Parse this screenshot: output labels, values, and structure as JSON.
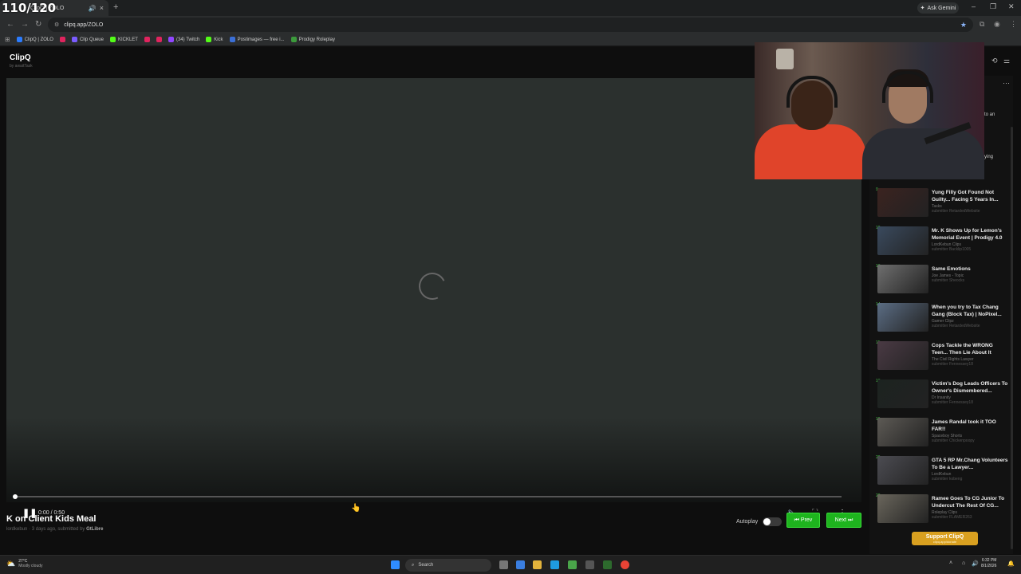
{
  "overlay": {
    "counter": "110/120"
  },
  "browser": {
    "tab_title": "ClipQ | ZOLO",
    "ask_gemini": "Ask Gemini",
    "url": "clipq.app/ZOLO",
    "bookmarks": [
      {
        "label": "ClipQ | ZOLO",
        "color": "#2b7cff"
      },
      {
        "label": "",
        "color": "#e0245e"
      },
      {
        "label": "Clip Queue",
        "color": "#7a5cff"
      },
      {
        "label": "KICKLET",
        "color": "#53fc18"
      },
      {
        "label": "",
        "color": "#e0245e"
      },
      {
        "label": "",
        "color": "#e0245e"
      },
      {
        "label": "(34) Twitch",
        "color": "#9146ff"
      },
      {
        "label": "Kick",
        "color": "#53fc18"
      },
      {
        "label": "Postimages — free i...",
        "color": "#3b6fd6"
      },
      {
        "label": "Prodigy Roleplay",
        "color": "#3c9a3c"
      }
    ]
  },
  "app": {
    "brand": "ClipQ",
    "brand_sub": "by awaitTask"
  },
  "player": {
    "time": "0:00 / 0:50",
    "progress": 0.0
  },
  "clip": {
    "title": "K on Client Kids Meal",
    "channel": "lordkebun",
    "ago": "3 days ago, submitted by",
    "submitter": "GtLibre"
  },
  "controls": {
    "autoplay_label": "Autoplay",
    "prev_label": "⏮ Prev",
    "next_label": "Next ⏭"
  },
  "sidebar": {
    "partial_texts": [
      "to an",
      "ying"
    ],
    "items": [
      {
        "num": "9",
        "title": "Yung Filly Got Found Not Guilty... Facing 5 Years In...",
        "channel": "Tasks",
        "submitter": "submitter RetardedWebsite",
        "thumb": "#3b2320"
      },
      {
        "num": "12",
        "title": "Mr. K Shows Up for Lemon's Memorial Event | Prodigy 4.0",
        "channel": "LordKebun Clips",
        "submitter": "submitter Backlip1005",
        "thumb": "#3a4a5e"
      },
      {
        "num": "13",
        "title": "Same Emotions",
        "channel": "Joe James - Topic",
        "submitter": "submitter Sheocks",
        "thumb": "#6f6f6f"
      },
      {
        "num": "14",
        "title": "When you try to Tax Chang Gang (Block Tax) | NoPixel...",
        "channel": "Gamer Clipz",
        "submitter": "submitter RetardedWebsite",
        "thumb": "#5b6d84"
      },
      {
        "num": "15",
        "title": "Cops Tackle the WRONG Teen... Then Lie About It",
        "channel": "The Civil Rights Lawyer",
        "submitter": "submitter Fennessey18",
        "thumb": "#4a3a44"
      },
      {
        "num": "18",
        "title": "Victim's Dog Leads Officers To Owner's Dismembered...",
        "channel": "Dr Insanity",
        "submitter": "submitter Fennessey18",
        "thumb": "#1c2320"
      },
      {
        "num": "19",
        "title": "James Randal took it TOO FAR!!",
        "channel": "Spaceboy Shorts",
        "submitter": "submitter Chickenpoopy",
        "thumb": "#5d5a55"
      },
      {
        "num": "20",
        "title": "GTA 5 RP Mr.Chang Volunteers To Be a Lawyer...",
        "channel": "LordKebun",
        "submitter": "submitter kobeng",
        "thumb": "#4c4c52"
      },
      {
        "num": "22",
        "title": "Ramee Goes To CG Junior To Undercut The Rest Of CG...",
        "channel": "Roleplay Clips",
        "submitter": "submitter FLAMER263",
        "thumb": "#6a665c"
      }
    ],
    "support_label": "Support ClipQ",
    "support_url": "clipq.app/donate"
  },
  "taskbar": {
    "temp": "27°C",
    "weather": "Mostly cloudy",
    "search": "Search",
    "time": "6:32 PM",
    "date": "8/1/2026"
  },
  "colors": {
    "accent_green": "#1eb41e",
    "support_gold": "#d9a020"
  }
}
